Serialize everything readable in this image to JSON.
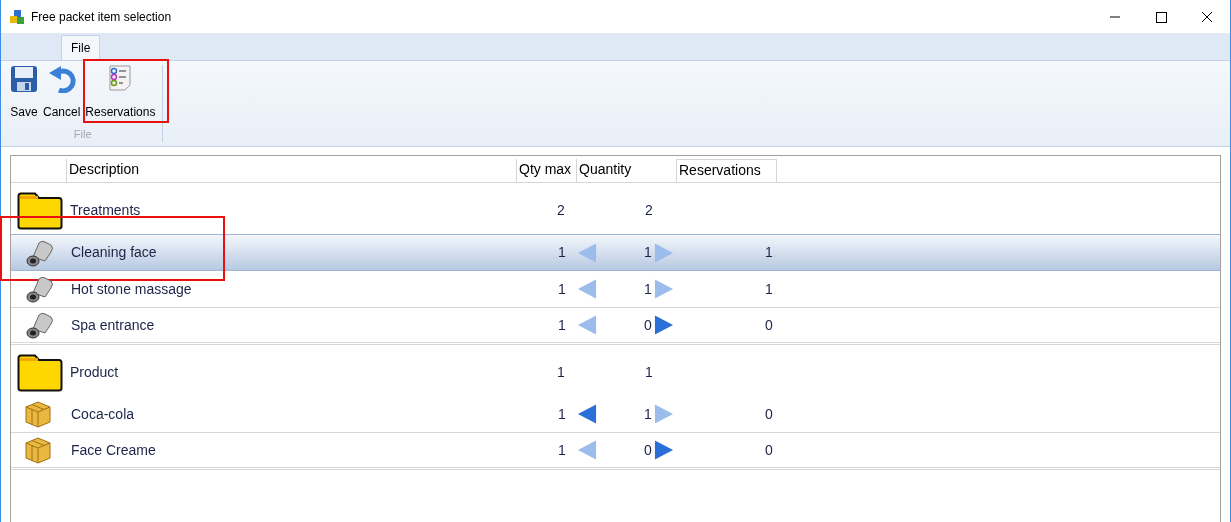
{
  "window": {
    "title": "Free packet item selection"
  },
  "tabs": [
    {
      "label": "File",
      "selected": true
    }
  ],
  "ribbon": {
    "buttons": [
      {
        "kind": "save",
        "label": "Save",
        "highlighted": false
      },
      {
        "kind": "cancel",
        "label": "Cancel",
        "highlighted": false
      },
      {
        "kind": "reservations",
        "label": "Reservations",
        "highlighted": true
      }
    ],
    "group_label": "File"
  },
  "table": {
    "columns": [
      "Description",
      "Qty max",
      "Quantity",
      "Reservations"
    ],
    "groups": [
      {
        "kind": "folder",
        "name": "Treatments",
        "qty_max": "2",
        "quantity": "2",
        "items": [
          {
            "kind": "glove",
            "name": "Cleaning face",
            "qty_max": "1",
            "quantity": "1",
            "reservations": "1",
            "can_decrease": false,
            "can_increase": false,
            "selected": true,
            "highlighted": true
          },
          {
            "kind": "glove",
            "name": "Hot stone massage",
            "qty_max": "1",
            "quantity": "1",
            "reservations": "1",
            "can_decrease": false,
            "can_increase": false,
            "selected": false,
            "highlighted": false
          },
          {
            "kind": "glove",
            "name": "Spa entrance",
            "qty_max": "1",
            "quantity": "0",
            "reservations": "0",
            "can_decrease": false,
            "can_increase": true,
            "selected": false,
            "highlighted": false
          }
        ]
      },
      {
        "kind": "folder",
        "name": "Product",
        "qty_max": "1",
        "quantity": "1",
        "items": [
          {
            "kind": "box",
            "name": "Coca-cola",
            "qty_max": "1",
            "quantity": "1",
            "reservations": "0",
            "can_decrease": true,
            "can_increase": false,
            "selected": false,
            "highlighted": false
          },
          {
            "kind": "box",
            "name": "Face Creame",
            "qty_max": "1",
            "quantity": "0",
            "reservations": "0",
            "can_decrease": false,
            "can_increase": true,
            "selected": false,
            "highlighted": false
          }
        ]
      }
    ]
  }
}
